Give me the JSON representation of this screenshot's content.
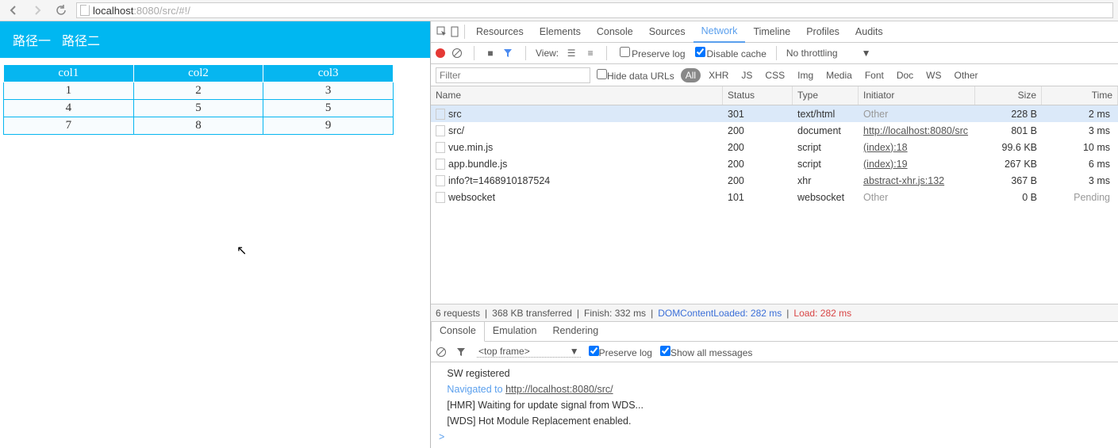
{
  "address": {
    "host": "localhost",
    "port": ":8080",
    "path": "/src/#!/"
  },
  "page": {
    "nav": [
      "路径一",
      "路径二"
    ],
    "table": {
      "headers": [
        "col1",
        "col2",
        "col3"
      ],
      "rows": [
        [
          "1",
          "2",
          "3"
        ],
        [
          "4",
          "5",
          "5"
        ],
        [
          "7",
          "8",
          "9"
        ]
      ]
    }
  },
  "devtools_tabs": [
    "Resources",
    "Elements",
    "Console",
    "Sources",
    "Network",
    "Timeline",
    "Profiles",
    "Audits"
  ],
  "devtools_active": "Network",
  "net_toolbar": {
    "view_label": "View:",
    "preserve_log": "Preserve log",
    "disable_cache": "Disable cache",
    "throttling": "No throttling"
  },
  "filter": {
    "placeholder": "Filter",
    "hide_urls": "Hide data URLs",
    "types": [
      "All",
      "XHR",
      "JS",
      "CSS",
      "Img",
      "Media",
      "Font",
      "Doc",
      "WS",
      "Other"
    ],
    "active": "All"
  },
  "grid": {
    "headers": [
      "Name",
      "Status",
      "Type",
      "Initiator",
      "Size",
      "Time"
    ],
    "rows": [
      {
        "name": "src",
        "status": "301",
        "type": "text/html",
        "initiator": "Other",
        "init_link": false,
        "size": "228 B",
        "time": "2 ms",
        "selected": true
      },
      {
        "name": "src/",
        "status": "200",
        "type": "document",
        "initiator": "http://localhost:8080/src",
        "init_link": true,
        "size": "801 B",
        "time": "3 ms"
      },
      {
        "name": "vue.min.js",
        "status": "200",
        "type": "script",
        "initiator": "(index):18",
        "init_link": true,
        "size": "99.6 KB",
        "time": "10 ms"
      },
      {
        "name": "app.bundle.js",
        "status": "200",
        "type": "script",
        "initiator": "(index):19",
        "init_link": true,
        "size": "267 KB",
        "time": "6 ms"
      },
      {
        "name": "info?t=1468910187524",
        "status": "200",
        "type": "xhr",
        "initiator": "abstract-xhr.js:132",
        "init_link": true,
        "size": "367 B",
        "time": "3 ms"
      },
      {
        "name": "websocket",
        "status": "101",
        "type": "websocket",
        "initiator": "Other",
        "init_link": false,
        "size": "0 B",
        "time": "Pending",
        "pending": true
      }
    ]
  },
  "summary": {
    "requests": "6 requests",
    "transferred": "368 KB transferred",
    "finish": "Finish: 332 ms",
    "dcl": "DOMContentLoaded: 282 ms",
    "load": "Load: 282 ms"
  },
  "drawer_tabs": [
    "Console",
    "Emulation",
    "Rendering"
  ],
  "drawer_active": "Console",
  "console_bar": {
    "frame": "<top frame>",
    "preserve": "Preserve log",
    "show_all": "Show all messages"
  },
  "console_lines": [
    {
      "text": "SW registered"
    },
    {
      "prefix": "Navigated to ",
      "link": "http://localhost:8080/src/",
      "nav": true
    },
    {
      "text": "[HMR] Waiting for update signal from WDS..."
    },
    {
      "text": "[WDS] Hot Module Replacement enabled."
    }
  ]
}
